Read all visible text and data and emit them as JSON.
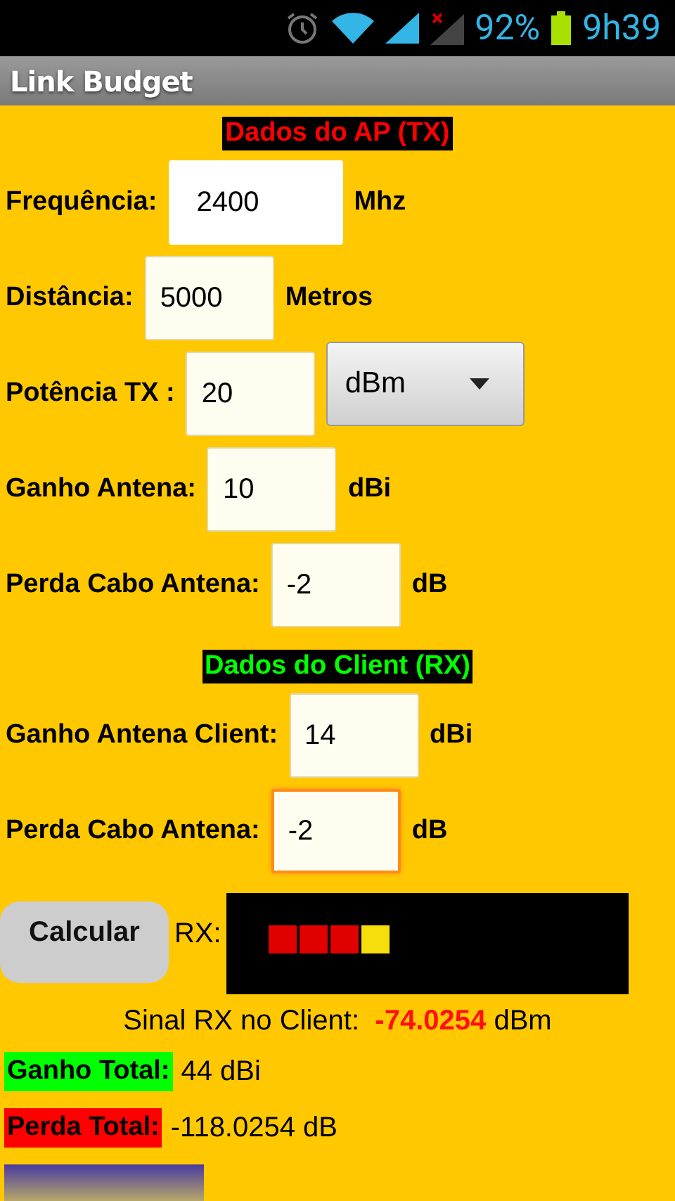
{
  "status_bar": {
    "battery": "92%",
    "time": "9h39"
  },
  "window": {
    "title": "Link Budget"
  },
  "sections": [
    {
      "header": "Dados do AP (TX)",
      "kind": "tx",
      "fields": [
        {
          "label": "Frequência:",
          "value": "2400",
          "unit": "Mhz",
          "kind": "plain",
          "focused": false
        },
        {
          "label": "Distância:",
          "value": "5000",
          "unit": "Metros",
          "kind": "boxed",
          "focused": false
        },
        {
          "label": "Potência TX :",
          "value": "20",
          "dropdown": "dBm",
          "kind": "boxed",
          "focused": false
        },
        {
          "label": "Ganho Antena:",
          "value": "10",
          "unit": "dBi",
          "kind": "boxed",
          "focused": false
        },
        {
          "label": "Perda Cabo Antena:",
          "value": "-2",
          "unit": "dB",
          "kind": "boxed",
          "focused": false
        }
      ]
    },
    {
      "header": "Dados do Client (RX)",
      "kind": "rx",
      "fields": [
        {
          "label": "Ganho Antena Client:",
          "value": "14",
          "unit": "dBi",
          "kind": "boxed",
          "focused": false
        },
        {
          "label": "Perda Cabo Antena:",
          "value": "-2",
          "unit": "dB",
          "kind": "boxed",
          "focused": true
        }
      ]
    }
  ],
  "calculate_button": "Calcular",
  "rx_meter": {
    "label": "RX:",
    "segments": [
      {
        "color": "#e00000"
      },
      {
        "color": "#e00000"
      },
      {
        "color": "#e00000"
      },
      {
        "color": "#f5de0c"
      }
    ]
  },
  "signal": {
    "label": "Sinal RX no Client:",
    "value": "-74.0254",
    "unit": "dBm"
  },
  "totals": [
    {
      "label": "Ganho Total:",
      "value": "44 dBi",
      "color": "#00ff00"
    },
    {
      "label": "Perda Total:",
      "value": "-118.0254 dB",
      "color": "#ff0000"
    }
  ]
}
